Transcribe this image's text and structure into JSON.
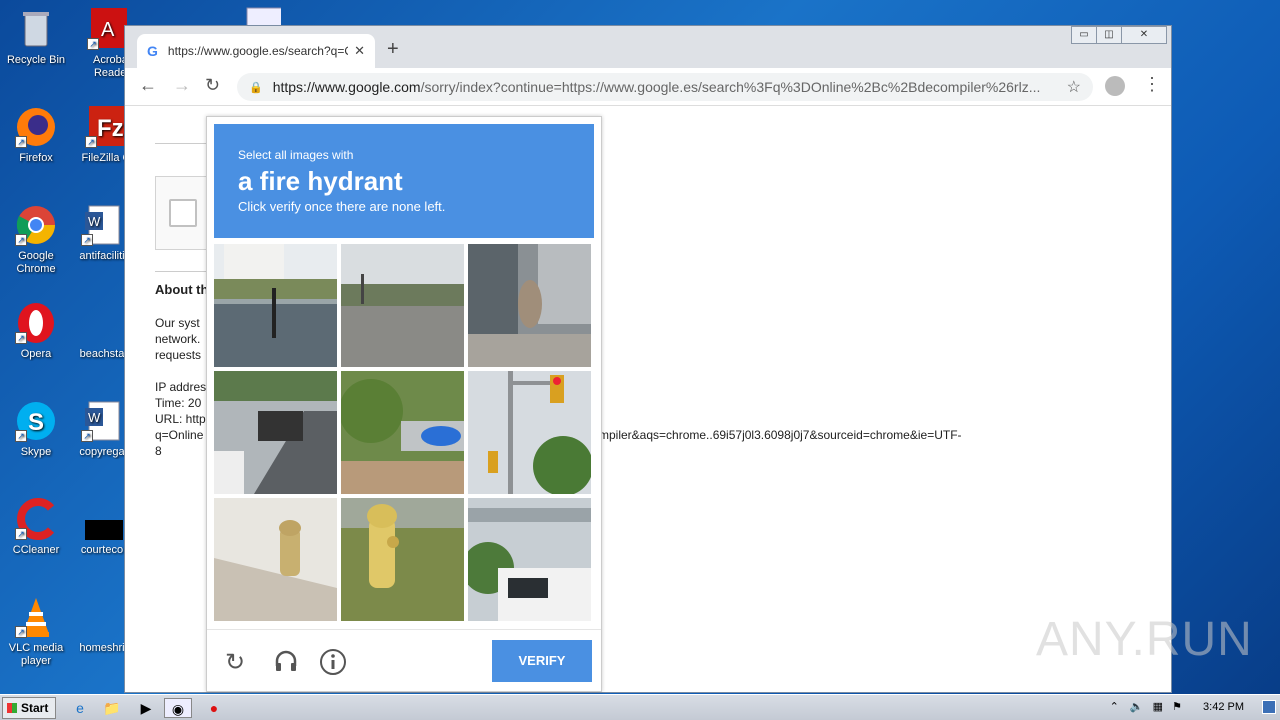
{
  "desktop": {
    "icons": [
      {
        "label": "Recycle Bin"
      },
      {
        "label": "Acrobat Reader"
      },
      {
        "label": "Firefox"
      },
      {
        "label": "FileZilla C"
      },
      {
        "label": "Google Chrome"
      },
      {
        "label": "antifaciliti"
      },
      {
        "label": "Opera"
      },
      {
        "label": "beachsta"
      },
      {
        "label": "Skype"
      },
      {
        "label": "copyrega"
      },
      {
        "label": "CCleaner"
      },
      {
        "label": "courteco"
      },
      {
        "label": "VLC media player"
      },
      {
        "label": "homeshri"
      }
    ]
  },
  "browser": {
    "tab_title": "https://www.google.es/search?q=O",
    "tab_favicon": "G",
    "url_domain": "https://www.google.com",
    "url_path": "/sorry/index?continue=https://www.google.es/search%3Fq%3DOnline%2Bc%2Bdecompiler%26rlz...",
    "window_controls": [
      "▭",
      "◫",
      "✕"
    ]
  },
  "page_behind": {
    "about_heading": "About th",
    "para1_l1": "Our syst",
    "para1_l2": "network.",
    "para1_l3": "requests",
    "ip_line": "IP addres",
    "time_line": "Time: 20",
    "url_line": "URL: http",
    "q_line": "q=Online",
    "eight": "8",
    "url_tail": "mpiler&aqs=chrome..69i57j0l3.6098j0j7&sourceid=chrome&ie=UTF-"
  },
  "captcha": {
    "instruction_small": "Select all images with",
    "target": "a fire hydrant",
    "instruction_sub": "Click verify once there are none left.",
    "verify_label": "VERIFY"
  },
  "taskbar": {
    "start_label": "Start",
    "clock": "3:42 PM"
  },
  "watermark": "ANY.RUN",
  "colors": {
    "captcha_blue": "#4a90e2",
    "desktop_blue": "#1a73c8"
  }
}
